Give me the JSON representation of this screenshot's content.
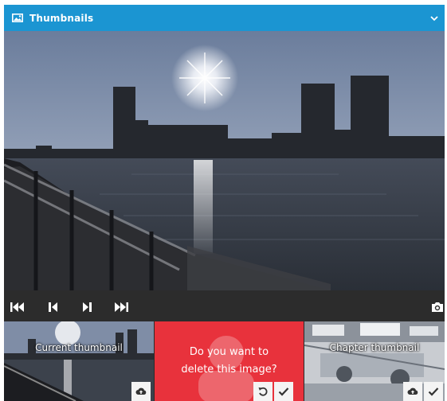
{
  "header": {
    "title": "Thumbnails",
    "icon": "image-icon",
    "toggle_icon": "chevron-down-icon",
    "color": "#1b95d2"
  },
  "player": {
    "controls": [
      {
        "name": "skip-to-start",
        "icon": "skip-start-icon"
      },
      {
        "name": "previous-frame",
        "icon": "step-back-icon"
      },
      {
        "name": "next-frame",
        "icon": "step-forward-icon"
      },
      {
        "name": "skip-to-end",
        "icon": "skip-end-icon"
      }
    ],
    "snapshot_icon": "camera-icon"
  },
  "thumbnails": [
    {
      "caption": "Current thumbnail",
      "action_icons": [
        "upload-icon"
      ]
    },
    {
      "prompt_line1": "Do you want to",
      "prompt_line2": "delete this image?",
      "action_icons": [
        "undo-icon",
        "check-icon"
      ],
      "color": "#e8323c"
    },
    {
      "caption": "Chapter thumbnail",
      "action_icons": [
        "upload-icon",
        "check-icon"
      ]
    }
  ]
}
